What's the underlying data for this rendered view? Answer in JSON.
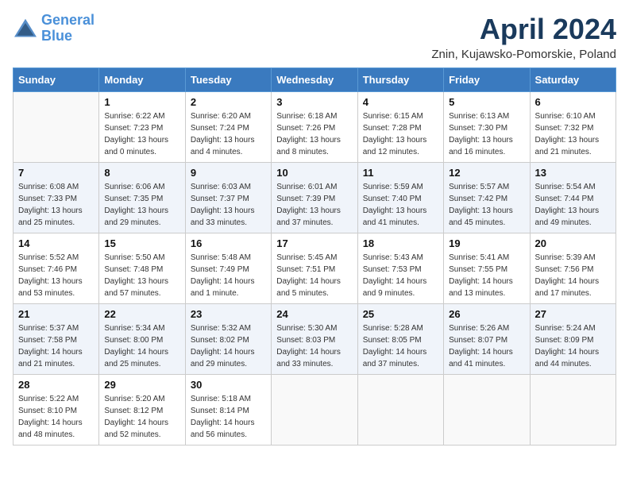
{
  "logo": {
    "line1": "General",
    "line2": "Blue"
  },
  "title": "April 2024",
  "location": "Znin, Kujawsko-Pomorskie, Poland",
  "days_of_week": [
    "Sunday",
    "Monday",
    "Tuesday",
    "Wednesday",
    "Thursday",
    "Friday",
    "Saturday"
  ],
  "weeks": [
    [
      {
        "day": "",
        "sunrise": "",
        "sunset": "",
        "daylight": ""
      },
      {
        "day": "1",
        "sunrise": "Sunrise: 6:22 AM",
        "sunset": "Sunset: 7:23 PM",
        "daylight": "Daylight: 13 hours and 0 minutes."
      },
      {
        "day": "2",
        "sunrise": "Sunrise: 6:20 AM",
        "sunset": "Sunset: 7:24 PM",
        "daylight": "Daylight: 13 hours and 4 minutes."
      },
      {
        "day": "3",
        "sunrise": "Sunrise: 6:18 AM",
        "sunset": "Sunset: 7:26 PM",
        "daylight": "Daylight: 13 hours and 8 minutes."
      },
      {
        "day": "4",
        "sunrise": "Sunrise: 6:15 AM",
        "sunset": "Sunset: 7:28 PM",
        "daylight": "Daylight: 13 hours and 12 minutes."
      },
      {
        "day": "5",
        "sunrise": "Sunrise: 6:13 AM",
        "sunset": "Sunset: 7:30 PM",
        "daylight": "Daylight: 13 hours and 16 minutes."
      },
      {
        "day": "6",
        "sunrise": "Sunrise: 6:10 AM",
        "sunset": "Sunset: 7:32 PM",
        "daylight": "Daylight: 13 hours and 21 minutes."
      }
    ],
    [
      {
        "day": "7",
        "sunrise": "Sunrise: 6:08 AM",
        "sunset": "Sunset: 7:33 PM",
        "daylight": "Daylight: 13 hours and 25 minutes."
      },
      {
        "day": "8",
        "sunrise": "Sunrise: 6:06 AM",
        "sunset": "Sunset: 7:35 PM",
        "daylight": "Daylight: 13 hours and 29 minutes."
      },
      {
        "day": "9",
        "sunrise": "Sunrise: 6:03 AM",
        "sunset": "Sunset: 7:37 PM",
        "daylight": "Daylight: 13 hours and 33 minutes."
      },
      {
        "day": "10",
        "sunrise": "Sunrise: 6:01 AM",
        "sunset": "Sunset: 7:39 PM",
        "daylight": "Daylight: 13 hours and 37 minutes."
      },
      {
        "day": "11",
        "sunrise": "Sunrise: 5:59 AM",
        "sunset": "Sunset: 7:40 PM",
        "daylight": "Daylight: 13 hours and 41 minutes."
      },
      {
        "day": "12",
        "sunrise": "Sunrise: 5:57 AM",
        "sunset": "Sunset: 7:42 PM",
        "daylight": "Daylight: 13 hours and 45 minutes."
      },
      {
        "day": "13",
        "sunrise": "Sunrise: 5:54 AM",
        "sunset": "Sunset: 7:44 PM",
        "daylight": "Daylight: 13 hours and 49 minutes."
      }
    ],
    [
      {
        "day": "14",
        "sunrise": "Sunrise: 5:52 AM",
        "sunset": "Sunset: 7:46 PM",
        "daylight": "Daylight: 13 hours and 53 minutes."
      },
      {
        "day": "15",
        "sunrise": "Sunrise: 5:50 AM",
        "sunset": "Sunset: 7:48 PM",
        "daylight": "Daylight: 13 hours and 57 minutes."
      },
      {
        "day": "16",
        "sunrise": "Sunrise: 5:48 AM",
        "sunset": "Sunset: 7:49 PM",
        "daylight": "Daylight: 14 hours and 1 minute."
      },
      {
        "day": "17",
        "sunrise": "Sunrise: 5:45 AM",
        "sunset": "Sunset: 7:51 PM",
        "daylight": "Daylight: 14 hours and 5 minutes."
      },
      {
        "day": "18",
        "sunrise": "Sunrise: 5:43 AM",
        "sunset": "Sunset: 7:53 PM",
        "daylight": "Daylight: 14 hours and 9 minutes."
      },
      {
        "day": "19",
        "sunrise": "Sunrise: 5:41 AM",
        "sunset": "Sunset: 7:55 PM",
        "daylight": "Daylight: 14 hours and 13 minutes."
      },
      {
        "day": "20",
        "sunrise": "Sunrise: 5:39 AM",
        "sunset": "Sunset: 7:56 PM",
        "daylight": "Daylight: 14 hours and 17 minutes."
      }
    ],
    [
      {
        "day": "21",
        "sunrise": "Sunrise: 5:37 AM",
        "sunset": "Sunset: 7:58 PM",
        "daylight": "Daylight: 14 hours and 21 minutes."
      },
      {
        "day": "22",
        "sunrise": "Sunrise: 5:34 AM",
        "sunset": "Sunset: 8:00 PM",
        "daylight": "Daylight: 14 hours and 25 minutes."
      },
      {
        "day": "23",
        "sunrise": "Sunrise: 5:32 AM",
        "sunset": "Sunset: 8:02 PM",
        "daylight": "Daylight: 14 hours and 29 minutes."
      },
      {
        "day": "24",
        "sunrise": "Sunrise: 5:30 AM",
        "sunset": "Sunset: 8:03 PM",
        "daylight": "Daylight: 14 hours and 33 minutes."
      },
      {
        "day": "25",
        "sunrise": "Sunrise: 5:28 AM",
        "sunset": "Sunset: 8:05 PM",
        "daylight": "Daylight: 14 hours and 37 minutes."
      },
      {
        "day": "26",
        "sunrise": "Sunrise: 5:26 AM",
        "sunset": "Sunset: 8:07 PM",
        "daylight": "Daylight: 14 hours and 41 minutes."
      },
      {
        "day": "27",
        "sunrise": "Sunrise: 5:24 AM",
        "sunset": "Sunset: 8:09 PM",
        "daylight": "Daylight: 14 hours and 44 minutes."
      }
    ],
    [
      {
        "day": "28",
        "sunrise": "Sunrise: 5:22 AM",
        "sunset": "Sunset: 8:10 PM",
        "daylight": "Daylight: 14 hours and 48 minutes."
      },
      {
        "day": "29",
        "sunrise": "Sunrise: 5:20 AM",
        "sunset": "Sunset: 8:12 PM",
        "daylight": "Daylight: 14 hours and 52 minutes."
      },
      {
        "day": "30",
        "sunrise": "Sunrise: 5:18 AM",
        "sunset": "Sunset: 8:14 PM",
        "daylight": "Daylight: 14 hours and 56 minutes."
      },
      {
        "day": "",
        "sunrise": "",
        "sunset": "",
        "daylight": ""
      },
      {
        "day": "",
        "sunrise": "",
        "sunset": "",
        "daylight": ""
      },
      {
        "day": "",
        "sunrise": "",
        "sunset": "",
        "daylight": ""
      },
      {
        "day": "",
        "sunrise": "",
        "sunset": "",
        "daylight": ""
      }
    ]
  ]
}
